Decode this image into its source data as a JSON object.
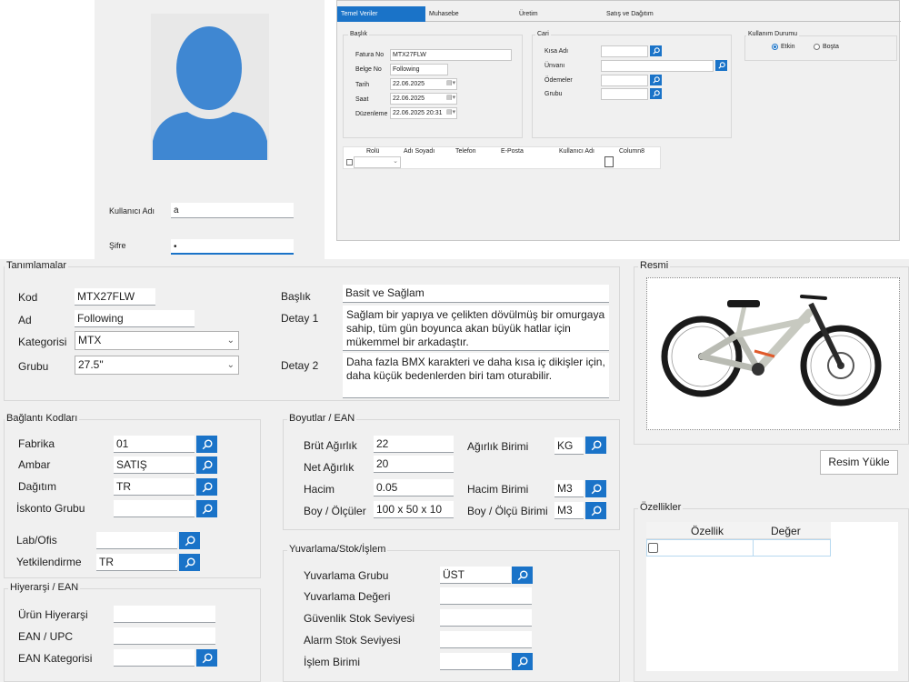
{
  "login": {
    "username_label": "Kullanıcı Adı",
    "username_value": "a",
    "password_label": "Şifre",
    "password_value": "•"
  },
  "top_form": {
    "tabs": [
      "Temel Veriler",
      "Muhasebe",
      "Üretim",
      "Satış ve Dağıtım"
    ],
    "baslik": {
      "title": "Başlık",
      "fatura_no_label": "Fatura No",
      "fatura_no_value": "MTX27FLW",
      "belge_no_label": "Belge No",
      "belge_no_value": "Following",
      "tarih_label": "Tarih",
      "tarih_value": "22.06.2025",
      "saat_label": "Saat",
      "saat_value": "22.06.2025",
      "duzenleme_label": "Düzenleme",
      "duzenleme_value": "22.06.2025 20:31"
    },
    "cari": {
      "title": "Cari",
      "kisa_adi_label": "Kısa Adı",
      "unvani_label": "Ünvanı",
      "odemeler_label": "Ödemeler",
      "grubu_label": "Grubu"
    },
    "kullanim": {
      "title": "Kullanım Durumu",
      "etkin_label": "Etkin",
      "bosta_label": "Boşta"
    },
    "grid": {
      "columns": [
        "Rolü",
        "Adı Soyadı",
        "Telefon",
        "E-Posta",
        "Kullanıcı Adı",
        "Column8"
      ]
    }
  },
  "tanimlamalar": {
    "title": "Tanımlamalar",
    "kod_label": "Kod",
    "kod_value": "MTX27FLW",
    "ad_label": "Ad",
    "ad_value": "Following",
    "kategorisi_label": "Kategorisi",
    "kategorisi_value": "MTX",
    "grubu_label": "Grubu",
    "grubu_value": "27.5\"",
    "baslik_label": "Başlık",
    "baslik_value": "Basit ve Sağlam",
    "detay1_label": "Detay 1",
    "detay1_value": "Sağlam bir yapıya ve çelikten dövülmüş bir omurgaya sahip, tüm gün boyunca akan büyük hatlar için mükemmel bir arkadaştır.",
    "detay2_label": "Detay 2",
    "detay2_value": "Daha fazla BMX karakteri ve daha kısa iç dikişler için, daha küçük bedenlerden biri tam oturabilir."
  },
  "resmi": {
    "title": "Resmi",
    "upload_button": "Resim Yükle"
  },
  "baglanti": {
    "title": "Bağlantı Kodları",
    "fabrika_label": "Fabrika",
    "fabrika_value": "01",
    "ambar_label": "Ambar",
    "ambar_value": "SATIŞ",
    "dagitim_label": "Dağıtım",
    "dagitim_value": "TR",
    "iskonto_label": "İskonto Grubu",
    "iskonto_value": "",
    "lab_label": "Lab/Ofis",
    "lab_value": "",
    "yetki_label": "Yetkilendirme",
    "yetki_value": "TR"
  },
  "boyutlar": {
    "title": "Boyutlar / EAN",
    "brut_label": "Brüt Ağırlık",
    "brut_value": "22",
    "net_label": "Net Ağırlık",
    "net_value": "20",
    "hacim_label": "Hacim",
    "hacim_value": "0.05",
    "boy_label": "Boy / Ölçüler",
    "boy_value": "100 x 50 x 10",
    "agirlik_birimi_label": "Ağırlık Birimi",
    "agirlik_birimi_value": "KG",
    "hacim_birimi_label": "Hacim Birimi",
    "hacim_birimi_value": "M3",
    "boy_birimi_label": "Boy / Ölçü Birimi",
    "boy_birimi_value": "M3"
  },
  "hiyerarsi": {
    "title": "Hiyerarşi / EAN",
    "urun_label": "Ürün Hiyerarşi",
    "ean_label": "EAN / UPC",
    "ean_kat_label": "EAN Kategorisi"
  },
  "yuvarlama": {
    "title": "Yuvarlama/Stok/İşlem",
    "grubu_label": "Yuvarlama Grubu",
    "grubu_value": "ÜST",
    "degeri_label": "Yuvarlama Değeri",
    "guvenlik_label": "Güvenlik Stok Seviyesi",
    "alarm_label": "Alarm Stok Seviyesi",
    "islem_label": "İşlem Birimi"
  },
  "ozellikler": {
    "title": "Özellikler",
    "col_ozellik": "Özellik",
    "col_deger": "Değer"
  },
  "colors": {
    "accent": "#1a73c8",
    "panel_bg": "#f0f0f0",
    "avatar": "#3f87d2"
  }
}
